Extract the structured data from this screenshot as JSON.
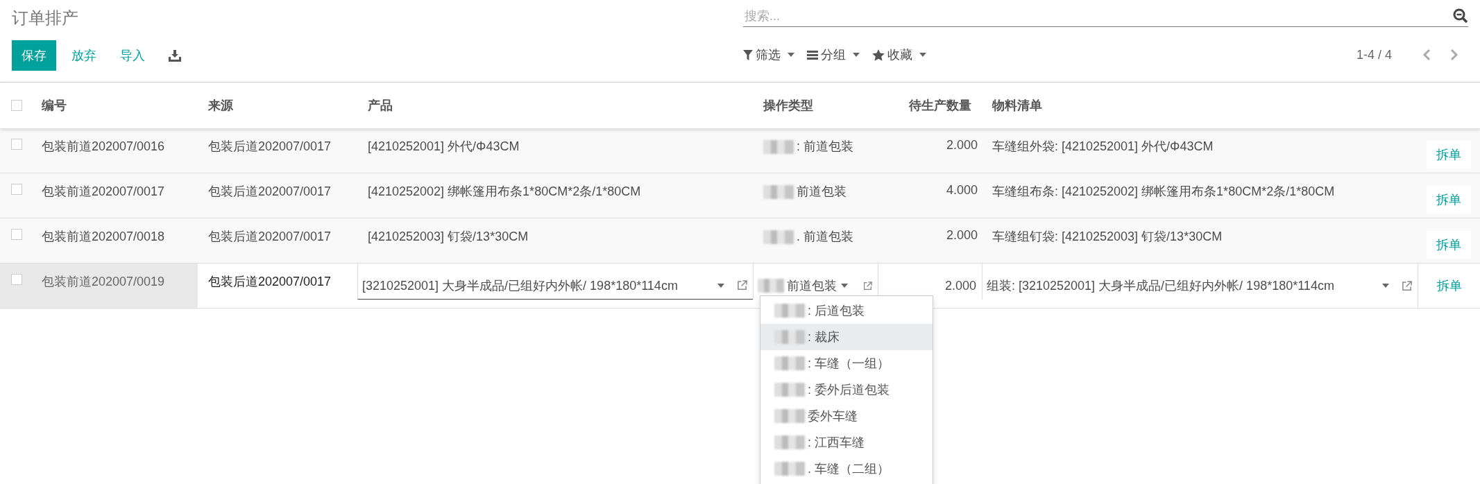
{
  "breadcrumb": "订单排产",
  "search": {
    "placeholder": "搜索..."
  },
  "buttons": [
    {
      "label": "保存",
      "kind": "primary"
    },
    {
      "label": "放弃",
      "kind": "link"
    },
    {
      "label": "导入",
      "kind": "link"
    },
    {
      "kind": "download"
    }
  ],
  "search_menus": [
    {
      "label": "筛选",
      "kind": "filter"
    },
    {
      "label": "分组",
      "kind": "group"
    },
    {
      "label": "收藏",
      "kind": "star"
    }
  ],
  "pager": "1-4 / 4",
  "table": {
    "select_all": {
      "checked": false
    },
    "columns": [
      "编号",
      "来源",
      "产品",
      "操作类型",
      "待生产数量",
      "物料清单"
    ],
    "rows": [
      {
        "checked": false,
        "editing": false,
        "name": "包装前道202007/0016",
        "source": "包装后道202007/0017",
        "product": "[4210252001] 外代/Φ43CM",
        "operation_type": ": 前道包装",
        "quantity": "2.000",
        "bom": "车缝组外袋: [4210252001] 外代/Φ43CM",
        "action": "拆单"
      },
      {
        "checked": false,
        "editing": false,
        "name": "包装前道202007/0017",
        "source": "包装后道202007/0017",
        "product": "[4210252002] 绑帐篷用布条1*80CM*2条/1*80CM",
        "operation_type": "前道包装",
        "quantity": "4.000",
        "bom": "车缝组布条: [4210252002] 绑帐篷用布条1*80CM*2条/1*80CM",
        "action": "拆单"
      },
      {
        "checked": false,
        "editing": false,
        "name": "包装前道202007/0018",
        "source": "包装后道202007/0017",
        "product": "[4210252003] 钉袋/13*30CM",
        "operation_type": ". 前道包装",
        "quantity": "2.000",
        "bom": "车缝组钉袋: [4210252003] 钉袋/13*30CM",
        "action": "拆单"
      },
      {
        "checked": false,
        "editing": true,
        "name": "包装前道202007/0019",
        "source": "包装后道202007/0017",
        "product": "[3210252001] 大身半成品/已组好内外帐/ 198*180*114cm",
        "operation_type": "前道包装",
        "quantity": "2.000",
        "bom": "组装: [3210252001] 大身半成品/已组好内外帐/ 198*180*114cm",
        "action": "拆单"
      }
    ]
  },
  "dropdown": [
    {
      "label": ": 后道包装",
      "selected": false
    },
    {
      "label": ": 裁床",
      "selected": true
    },
    {
      "label": ": 车缝（一组）",
      "selected": false
    },
    {
      "label": ": 委外后道包装",
      "selected": false
    },
    {
      "label": "委外车缝",
      "selected": false
    },
    {
      "label": ": 江西车缝",
      "selected": false
    },
    {
      "label": ". 车缝（二组）",
      "selected": false
    }
  ]
}
